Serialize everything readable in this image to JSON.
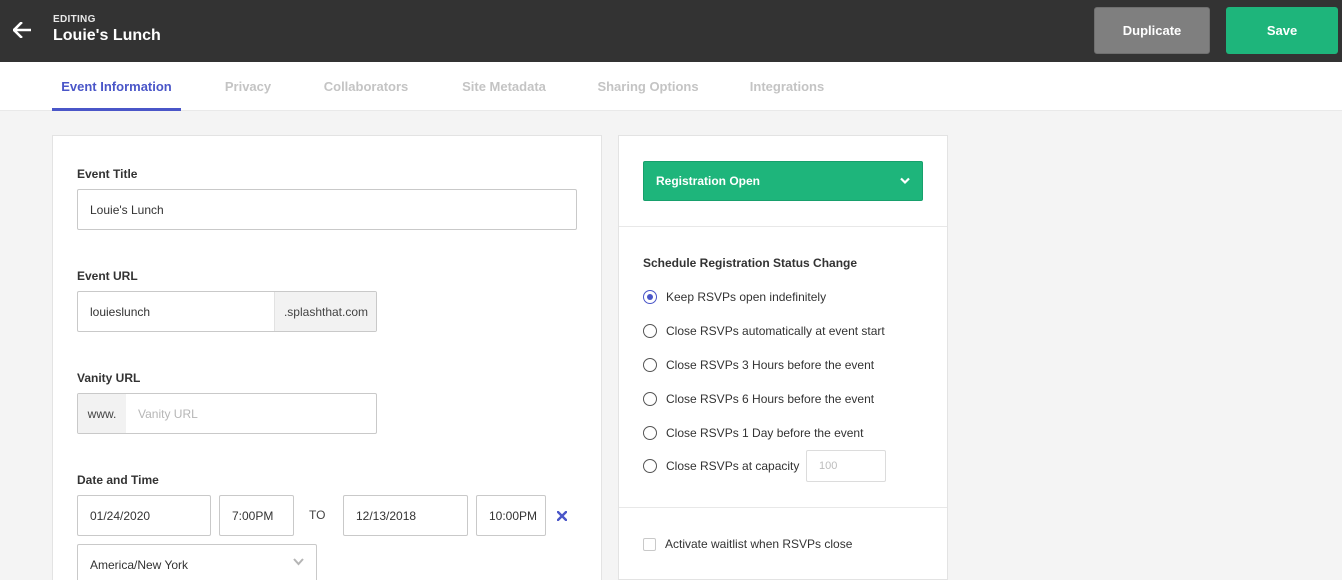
{
  "header": {
    "editing_label": "EDITING",
    "event_name": "Louie's Lunch",
    "duplicate_label": "Duplicate",
    "save_label": "Save"
  },
  "tabs": [
    {
      "label": "Event Information",
      "active": true
    },
    {
      "label": "Privacy",
      "active": false
    },
    {
      "label": "Collaborators",
      "active": false
    },
    {
      "label": "Site Metadata",
      "active": false
    },
    {
      "label": "Sharing Options",
      "active": false
    },
    {
      "label": "Integrations",
      "active": false
    }
  ],
  "form": {
    "event_title": {
      "label": "Event Title",
      "value": "Louie's Lunch"
    },
    "event_url": {
      "label": "Event URL",
      "value": "louieslunch",
      "suffix": ".splashthat.com"
    },
    "vanity_url": {
      "label": "Vanity URL",
      "prefix": "www.",
      "placeholder": "Vanity URL"
    },
    "date_time": {
      "label": "Date and Time",
      "start_date": "01/24/2020",
      "start_time": "7:00PM",
      "to_label": "TO",
      "end_date": "12/13/2018",
      "end_time": "10:00PM",
      "timezone": "America/New York"
    }
  },
  "registration": {
    "status": "Registration Open",
    "schedule_title": "Schedule Registration Status Change",
    "options": [
      {
        "label": "Keep RSVPs open indefinitely",
        "checked": true
      },
      {
        "label": "Close RSVPs automatically at event start",
        "checked": false
      },
      {
        "label": "Close RSVPs 3 Hours before the event",
        "checked": false
      },
      {
        "label": "Close RSVPs 6 Hours before the event",
        "checked": false
      },
      {
        "label": "Close RSVPs 1 Day before the event",
        "checked": false
      },
      {
        "label": "Close RSVPs at capacity",
        "checked": false
      }
    ],
    "capacity_placeholder": "100",
    "waitlist_label": "Activate waitlist when RSVPs close"
  },
  "colors": {
    "accent": "#4a56c8",
    "success": "#1eb57b",
    "header_bg": "#333333",
    "duplicate_bg": "#7f7f7f"
  },
  "icons": {
    "back": "arrow-left-icon",
    "dropdown": "chevron-down-icon",
    "clear": "close-x-icon"
  }
}
